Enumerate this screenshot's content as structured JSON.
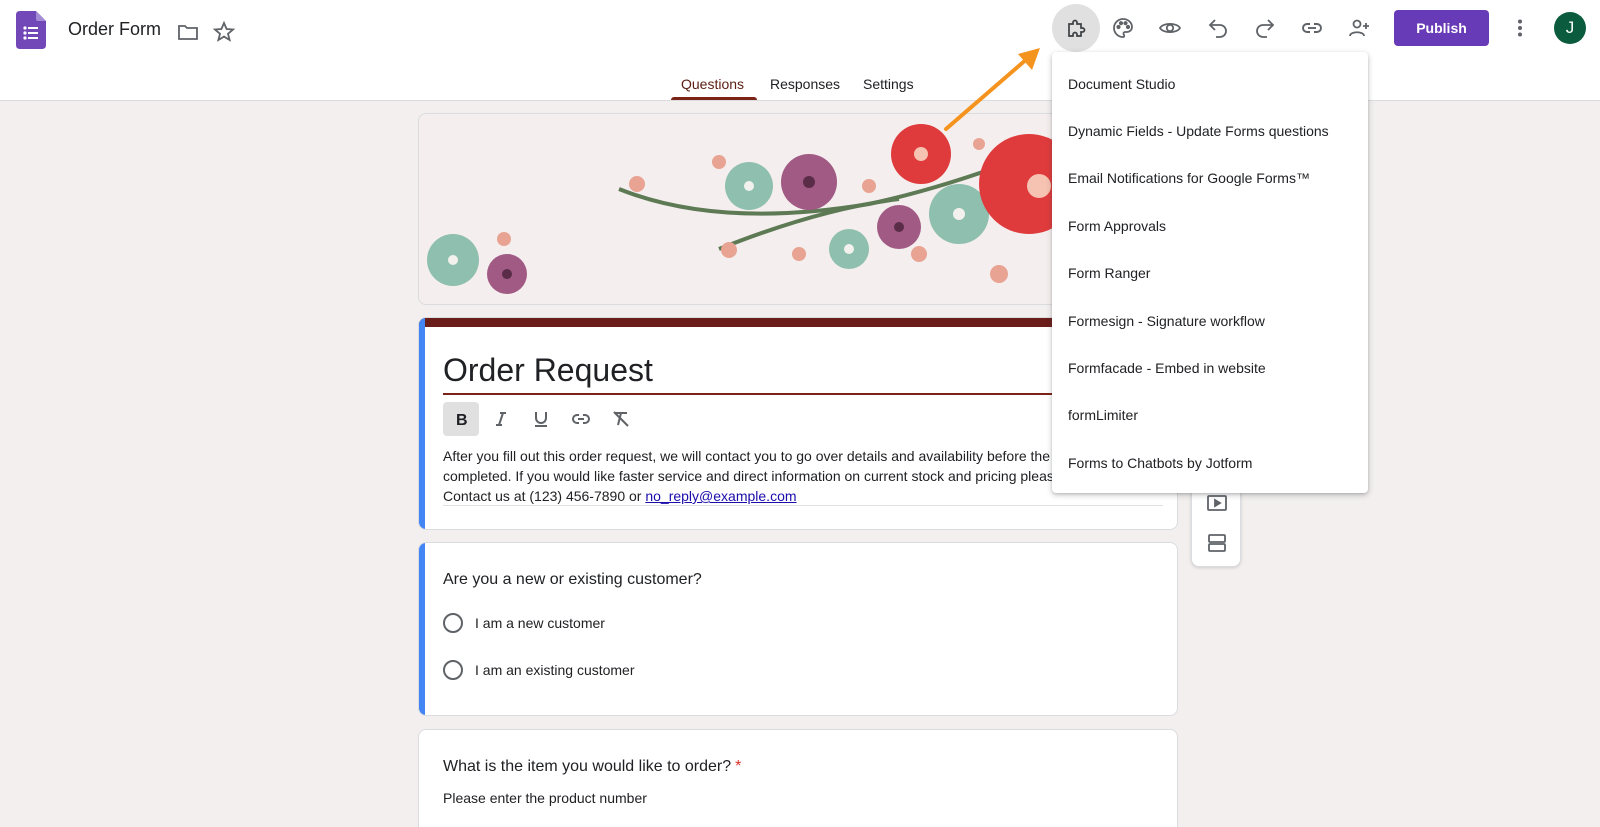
{
  "header": {
    "doc_title": "Order Form",
    "publish_label": "Publish",
    "avatar_initial": "J"
  },
  "tabs": [
    {
      "label": "Questions"
    },
    {
      "label": "Responses"
    },
    {
      "label": "Settings"
    }
  ],
  "addons_menu": {
    "items": [
      "Document Studio",
      "Dynamic Fields - Update Forms questions",
      "Email Notifications for Google Forms™",
      "Form Approvals",
      "Form Ranger",
      "Formesign - Signature workflow",
      "Formfacade - Embed in website",
      "formLimiter",
      "Forms to Chatbots by Jotform"
    ]
  },
  "form": {
    "title": "Order Request",
    "description_text": "After you fill out this order request, we will contact you to go over details and availability before the order is completed. If you would like faster service and direct information on current stock and pricing please contact us at Contact us at (123) 456-7890 or ",
    "description_email": "no_reply@example.com"
  },
  "question1": {
    "text": "Are you a new or existing customer?",
    "options": [
      "I am a new customer",
      "I am an existing customer"
    ]
  },
  "question2": {
    "text": "What is the item you would like to order?",
    "required_mark": "*",
    "help": "Please enter the product number"
  },
  "colors": {
    "accent": "#673ab7",
    "theme": "#6b1d1a",
    "focus": "#4285f4",
    "arrow": "#f5931f"
  }
}
